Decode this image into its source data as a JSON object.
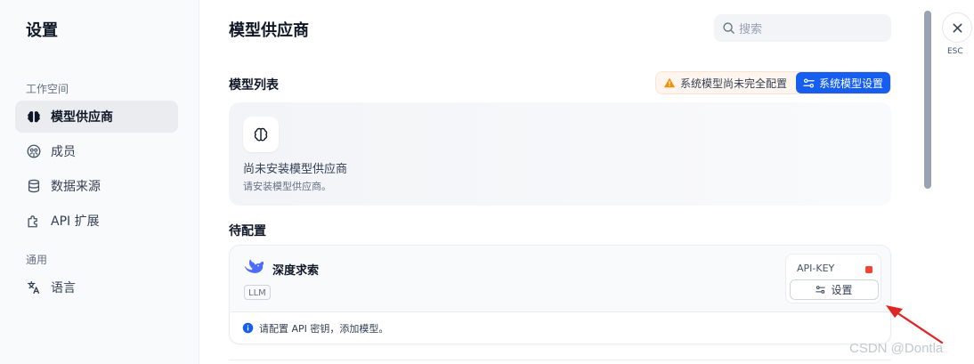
{
  "sidebar": {
    "title": "设置",
    "sections": [
      {
        "label": "工作空间"
      },
      {
        "label": "通用"
      }
    ],
    "items": [
      {
        "label": "模型供应商",
        "icon": "brain-icon",
        "active": true
      },
      {
        "label": "成员",
        "icon": "members-icon"
      },
      {
        "label": "数据来源",
        "icon": "database-icon"
      },
      {
        "label": "API 扩展",
        "icon": "puzzle-icon"
      },
      {
        "label": "语言",
        "icon": "translate-icon"
      }
    ]
  },
  "main": {
    "title": "模型供应商",
    "search": {
      "placeholder": "搜索"
    },
    "model_list": {
      "title": "模型列表",
      "warning": "系统模型尚未完全配置",
      "system_settings_button": "系统模型设置"
    },
    "empty_state": {
      "icon": "brain-icon",
      "title": "尚未安装模型供应商",
      "description": "请安装模型供应商。"
    },
    "pending": {
      "title": "待配置",
      "providers": [
        {
          "name": "深度求索",
          "icon": "deepseek-whale-icon",
          "tag": "LLM",
          "key_label": "API-KEY",
          "key_status_color": "#f04438",
          "setup_button": "设置",
          "notice": "请配置 API 密钥，添加模型。"
        }
      ]
    }
  },
  "close": {
    "label": "ESC",
    "icon": "close-icon"
  },
  "watermark": "CSDN @Dontla",
  "colors": {
    "accent": "#155eef",
    "warning": "#f79009",
    "error": "#f04438"
  }
}
